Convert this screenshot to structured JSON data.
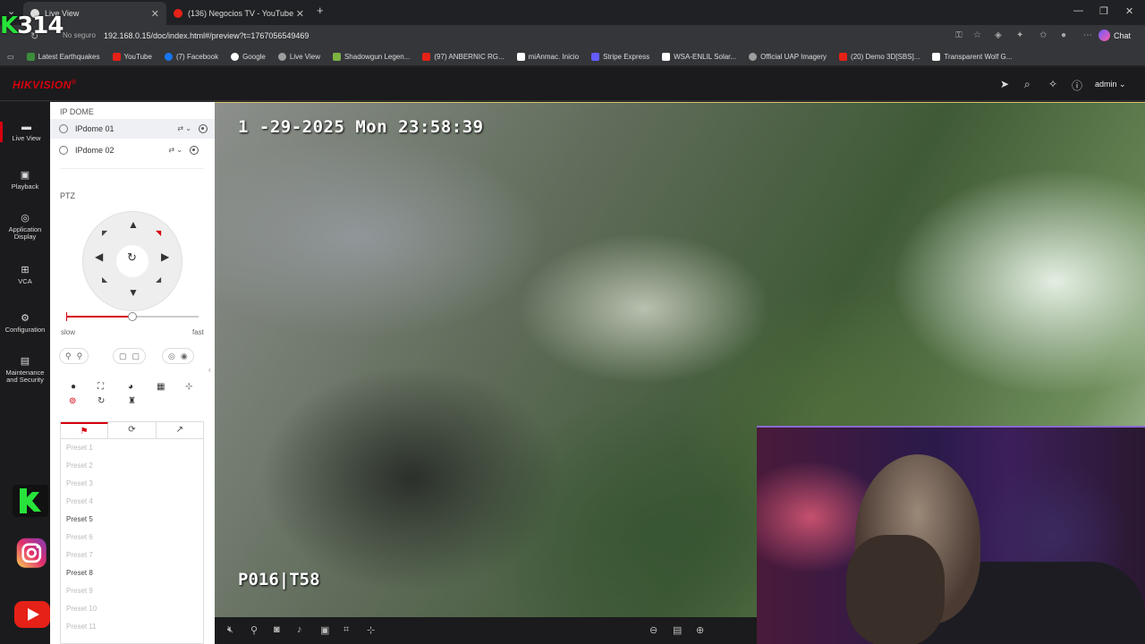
{
  "browser": {
    "tabs": [
      {
        "title": "Live View",
        "active": true
      },
      {
        "title": "(136) Negocios TV - YouTube",
        "active": false
      }
    ],
    "new_tab": "+",
    "window_controls": {
      "minimize": "—",
      "restore": "❐",
      "close": "✕"
    },
    "security_label": "No seguro",
    "url": "192.168.0.15/doc/index.html#/preview?t=1767056549469",
    "chat_label": "Chat",
    "bookmarks": [
      {
        "label": "Latest Earthquakes",
        "color": "#3b8c3b"
      },
      {
        "label": "YouTube",
        "color": "#e62117"
      },
      {
        "label": "(7) Facebook",
        "color": "#1877f2"
      },
      {
        "label": "Google",
        "color": "#ffffff"
      },
      {
        "label": "Live View",
        "color": "#9e9e9e"
      },
      {
        "label": "Shadowgun Legen...",
        "color": "#7cb342"
      },
      {
        "label": "(97) ANBERNIC RG...",
        "color": "#e62117"
      },
      {
        "label": "miAnmac. Inicio",
        "color": "#ffffff"
      },
      {
        "label": "Stripe Express",
        "color": "#635bff"
      },
      {
        "label": "WSA-ENLIL Solar...",
        "color": "#ffffff"
      },
      {
        "label": "Official UAP Imagery",
        "color": "#9e9e9e"
      },
      {
        "label": "(20) Demo 3D[SBS]...",
        "color": "#e62117"
      },
      {
        "label": "Transparent Wolf G...",
        "color": "#ffffff"
      }
    ]
  },
  "overlay_logo": {
    "k": "K",
    "num": "314"
  },
  "app": {
    "brand": "HIKVISION",
    "brand_mark": "®",
    "user": "admin",
    "nav": [
      {
        "label": "Live View",
        "active": true
      },
      {
        "label": "Playback"
      },
      {
        "label": "Application Display"
      },
      {
        "label": "VCA"
      },
      {
        "label": "Configuration"
      },
      {
        "label": "Maintenance and Security"
      }
    ],
    "camera_group": "IP DOME",
    "cameras": [
      "IPdome 01",
      "IPdome 02"
    ],
    "ptz_title": "PTZ",
    "speed": {
      "min_label": "slow",
      "max_label": "fast",
      "level": 0.5
    },
    "presets": [
      {
        "label": "Preset 1",
        "set": false
      },
      {
        "label": "Preset 2",
        "set": false
      },
      {
        "label": "Preset 3",
        "set": false
      },
      {
        "label": "Preset 4",
        "set": false
      },
      {
        "label": "Preset 5",
        "set": true
      },
      {
        "label": "Preset 6",
        "set": false
      },
      {
        "label": "Preset 7",
        "set": false
      },
      {
        "label": "Preset 8",
        "set": true
      },
      {
        "label": "Preset 9",
        "set": false
      },
      {
        "label": "Preset 10",
        "set": false
      },
      {
        "label": "Preset 11",
        "set": false
      }
    ]
  },
  "video": {
    "osd_datetime": "1 -29-2025 Mon 23:58:39",
    "osd_ptz": "P016|T58"
  },
  "colors": {
    "accent": "#d7000f",
    "panel_bg": "#ffffff",
    "header_bg": "#1b1b1d"
  }
}
